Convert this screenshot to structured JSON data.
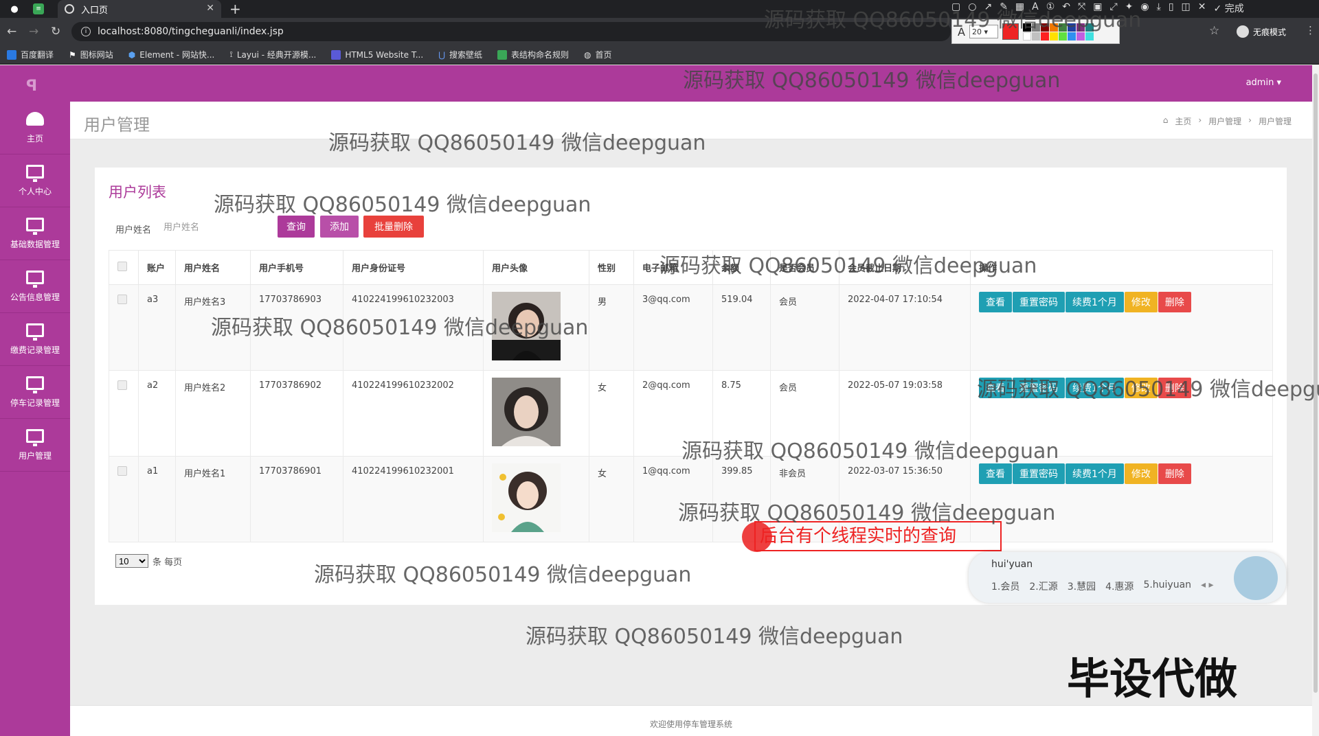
{
  "browser": {
    "tab_title": "入口页",
    "url": "localhost:8080/tingcheguanli/index.jsp",
    "incognito_label": "无痕模式",
    "bookmarks": [
      "百度翻译",
      "图标网站",
      "Element - 网站快...",
      "Layui - 经典开源模...",
      "HTML5 Website T...",
      "搜索壁纸",
      "表结构命名规则",
      "首页"
    ],
    "done_label": "完成"
  },
  "annotation_toolbar": {
    "font_size": "20",
    "current_color": "#ee2424"
  },
  "app": {
    "admin_label": "admin",
    "page_title": "用户管理",
    "breadcrumb": [
      "主页",
      "用户管理",
      "用户管理"
    ],
    "sidebar": [
      {
        "label": "主页",
        "icon": "dashboard-icon"
      },
      {
        "label": "个人中心",
        "icon": "monitor-icon"
      },
      {
        "label": "基础数据管理",
        "icon": "monitor-icon"
      },
      {
        "label": "公告信息管理",
        "icon": "monitor-icon"
      },
      {
        "label": "缴费记录管理",
        "icon": "monitor-icon"
      },
      {
        "label": "停车记录管理",
        "icon": "monitor-icon"
      },
      {
        "label": "用户管理",
        "icon": "monitor-icon"
      }
    ],
    "panel_title": "用户列表",
    "search": {
      "label": "用户姓名",
      "placeholder": "用户姓名"
    },
    "buttons": {
      "query": "查询",
      "add": "添加",
      "batch_delete": "批量删除"
    },
    "table": {
      "headers": [
        "账户",
        "用户姓名",
        "用户手机号",
        "用户身份证号",
        "用户头像",
        "性别",
        "电子邮箱",
        "余额",
        "是否会员",
        "会员截止日期",
        "操作"
      ],
      "rows": [
        {
          "account": "a3",
          "name": "用户姓名3",
          "phone": "17703786903",
          "id_card": "410224199610232003",
          "gender": "男",
          "email": "3@qq.com",
          "balance": "519.04",
          "member": "会员",
          "member_until": "2022-04-07 17:10:54"
        },
        {
          "account": "a2",
          "name": "用户姓名2",
          "phone": "17703786902",
          "id_card": "410224199610232002",
          "gender": "女",
          "email": "2@qq.com",
          "balance": "8.75",
          "member": "会员",
          "member_until": "2022-05-07 19:03:58"
        },
        {
          "account": "a1",
          "name": "用户姓名1",
          "phone": "17703786901",
          "id_card": "410224199610232001",
          "gender": "女",
          "email": "1@qq.com",
          "balance": "399.85",
          "member": "非会员",
          "member_until": "2022-03-07 15:36:50"
        }
      ],
      "actions": [
        "查看",
        "重置密码",
        "续费1个月",
        "修改",
        "删除"
      ]
    },
    "pager": {
      "page_size": "10",
      "suffix": "条 每页"
    },
    "footer": "欢迎使用停车管理系统"
  },
  "colors": {
    "theme": "#ac3a9a",
    "btn_query": "#ac3a9a",
    "btn_add": "#b84fa8",
    "btn_delete": "#e8413c",
    "op_teal": "#1f9fb3",
    "op_yellow": "#f0b323",
    "op_red": "#e84a4a"
  },
  "ime": {
    "input": "hui'yuan",
    "candidates": [
      "1.会员",
      "2.汇源",
      "3.慧园",
      "4.惠源",
      "5.huiyuan"
    ]
  },
  "overlay": {
    "watermark": "源码获取 QQ86050149 微信deepguan",
    "note": "后台有个线程实时的查询",
    "stamp": "毕设代做"
  }
}
